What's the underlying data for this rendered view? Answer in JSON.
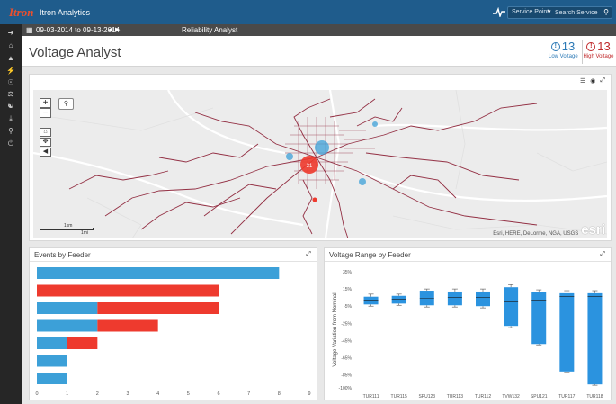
{
  "app": {
    "brand": "Itron",
    "title": "Itron Analytics",
    "search_type": "Service Point",
    "search_placeholder": "Search Service Point"
  },
  "datebar": {
    "date_range": "09-03-2014 to 09-13-2014",
    "module_title": "Reliability Analyst"
  },
  "page": {
    "title": "Voltage Analyst",
    "low_count": "13",
    "low_label": "Low Voltage",
    "high_count": "13",
    "high_label": "High Voltage"
  },
  "map": {
    "scale_km": "1km",
    "scale_mi": "1mi",
    "attribution": "Esri, HERE, DeLorme, NGA, USGS",
    "logo_text": "esri",
    "cluster_count": "31"
  },
  "colors": {
    "blue": "#3ca0d8",
    "red": "#ee3a2e",
    "box_blue": "#2b93df"
  },
  "events_panel": {
    "title": "Events by Feeder"
  },
  "range_panel": {
    "title": "Voltage Range by Feeder"
  },
  "chart_data": [
    {
      "type": "bar",
      "orientation": "horizontal",
      "stacked": true,
      "title": "Events by Feeder",
      "xlim": [
        0,
        9
      ],
      "xticks": [
        0,
        1,
        2,
        3,
        4,
        5,
        6,
        7,
        8,
        9
      ],
      "grid": false,
      "bars": [
        {
          "blue": 8,
          "red": 0
        },
        {
          "blue": 0,
          "red": 6
        },
        {
          "blue": 2,
          "red": 4
        },
        {
          "blue": 2,
          "red": 2
        },
        {
          "blue": 1,
          "red": 1
        },
        {
          "blue": 1,
          "red": 0
        },
        {
          "blue": 1,
          "red": 0
        }
      ]
    },
    {
      "type": "box",
      "title": "Voltage Range by Feeder",
      "ylabel": "Voltage Variation from Nominal",
      "ylim": [
        -100,
        35
      ],
      "yticks": [
        "35%",
        "15%",
        "-5%",
        "-25%",
        "-45%",
        "-65%",
        "-85%",
        "-100%"
      ],
      "ytick_values": [
        35,
        15,
        -5,
        -25,
        -45,
        -65,
        -85,
        -100
      ],
      "categories": [
        "TUR111",
        "TUR115",
        "SPU123",
        "TUR113",
        "TUR112",
        "TVW132",
        "SPU121",
        "TUR117",
        "TUR118"
      ],
      "boxes": [
        {
          "min": -5,
          "q1": -3,
          "median": 2,
          "q3": 6,
          "max": 9
        },
        {
          "min": -4,
          "q1": -2,
          "median": 3,
          "q3": 7,
          "max": 9
        },
        {
          "min": -6,
          "q1": -4,
          "median": 4,
          "q3": 13,
          "max": 15
        },
        {
          "min": -6,
          "q1": -4,
          "median": 5,
          "q3": 12,
          "max": 15
        },
        {
          "min": -7,
          "q1": -5,
          "median": 5,
          "q3": 12,
          "max": 15
        },
        {
          "min": -30,
          "q1": -28,
          "median": 0,
          "q3": 17,
          "max": 20
        },
        {
          "min": -50,
          "q1": -49,
          "median": 2,
          "q3": 11,
          "max": 14
        },
        {
          "min": -82,
          "q1": -81,
          "median": 6,
          "q3": 10,
          "max": 13
        },
        {
          "min": -97,
          "q1": -96,
          "median": 6,
          "q3": 10,
          "max": 13
        }
      ]
    }
  ]
}
